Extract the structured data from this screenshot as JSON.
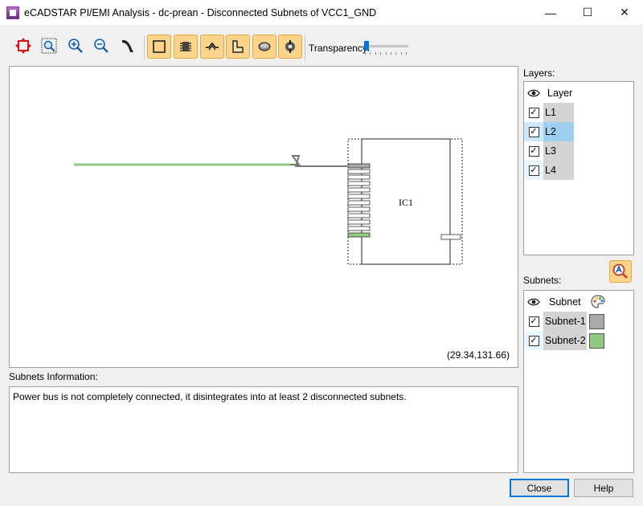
{
  "window": {
    "title": "eCADSTAR PI/EMI Analysis - dc-prean - Disconnected Subnets of VCC1_GND",
    "minimize": "—",
    "maximize": "☐",
    "close": "✕"
  },
  "toolbar": {
    "buttons": [
      {
        "name": "fit-all-icon"
      },
      {
        "name": "zoom-window-icon"
      },
      {
        "name": "zoom-in-icon"
      },
      {
        "name": "zoom-out-icon"
      },
      {
        "name": "pan-icon"
      }
    ],
    "toggles": [
      {
        "name": "outline-icon",
        "active": true
      },
      {
        "name": "component-icon",
        "active": true
      },
      {
        "name": "trace-icon",
        "active": true
      },
      {
        "name": "plane-icon",
        "active": true
      },
      {
        "name": "via-icon",
        "active": true
      },
      {
        "name": "pin-icon",
        "active": true
      }
    ],
    "transparency_label": "Transparency:",
    "transparency_value": 0
  },
  "canvas": {
    "component_label": "IC1",
    "coordinates": "(29.34,131.66)"
  },
  "info": {
    "label": "Subnets Information:",
    "text": "Power bus is not completely connected, it disintegrates into at least 2 disconnected subnets."
  },
  "layers": {
    "label": "Layers:",
    "header": "Layer",
    "items": [
      {
        "name": "L1",
        "checked": true,
        "selected": false
      },
      {
        "name": "L2",
        "checked": true,
        "selected": true
      },
      {
        "name": "L3",
        "checked": true,
        "selected": false
      },
      {
        "name": "L4",
        "checked": true,
        "selected": false
      }
    ]
  },
  "subnets": {
    "label": "Subnets:",
    "header": "Subnet",
    "items": [
      {
        "name": "Subnet-1",
        "checked": true,
        "color": "#a8a8a8"
      },
      {
        "name": "Subnet-2",
        "checked": true,
        "color": "#8fca7f"
      }
    ]
  },
  "buttons": {
    "close": "Close",
    "help": "Help"
  },
  "colors": {
    "toggle_bg": "#fbd38a",
    "subnet1": "#a8a8a8",
    "subnet2": "#8fca7f",
    "selection": "#9fcfef"
  }
}
